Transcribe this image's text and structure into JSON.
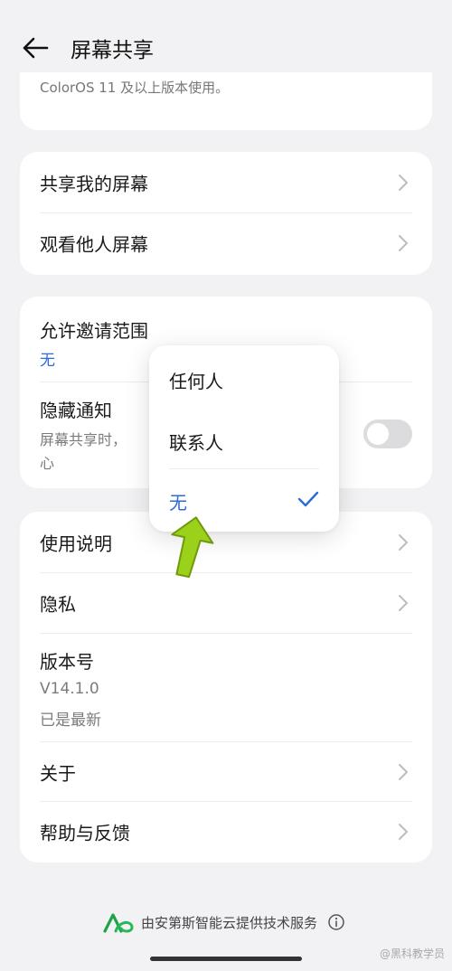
{
  "header": {
    "title": "屏幕共享",
    "back_icon": "arrow-left-icon"
  },
  "top_card": {
    "note": "ColorOS 11 及以上版本使用。"
  },
  "share_card": {
    "items": [
      {
        "label": "共享我的屏幕"
      },
      {
        "label": "观看他人屏幕"
      }
    ]
  },
  "privacy_card": {
    "invite_scope_label": "允许邀请范围",
    "invite_scope_value": "无",
    "hide_notice_label": "隐藏通知",
    "hide_notice_desc_1": "屏幕共享时，",
    "hide_notice_desc_2": "心",
    "hide_notice_toggle": false
  },
  "popup_menu": {
    "options": [
      {
        "label": "任何人",
        "selected": false
      },
      {
        "label": "联系人",
        "selected": false
      },
      {
        "label": "无",
        "selected": true
      }
    ]
  },
  "help_card": {
    "usage_label": "使用说明",
    "privacy_label": "隐私",
    "version_label": "版本号",
    "version_number": "V14.1.0",
    "version_status": "已是最新",
    "about_label": "关于",
    "feedback_label": "帮助与反馈"
  },
  "footer": {
    "text": "由安第斯智能云提供技术服务"
  },
  "watermark": "@黑科教学员",
  "colors": {
    "accent": "#2f6bd8",
    "background": "#f2f2f4",
    "arrow": "#9bd11a"
  }
}
